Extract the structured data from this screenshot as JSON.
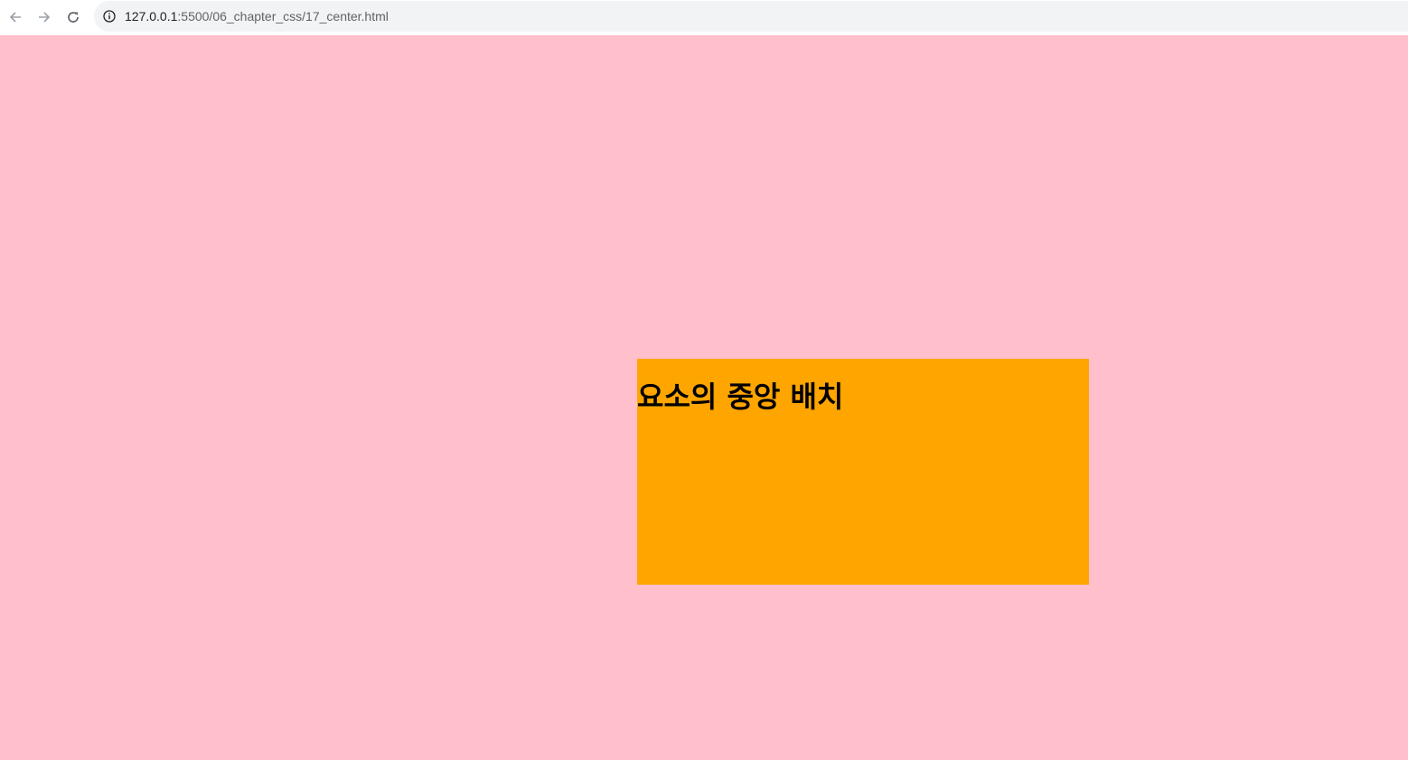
{
  "browser": {
    "url_host": "127.0.0.1",
    "url_path": ":5500/06_chapter_css/17_center.html",
    "icons": {
      "back": "arrow-left-icon",
      "forward": "arrow-right-icon",
      "reload": "reload-icon",
      "info": "info-icon"
    }
  },
  "page": {
    "background_color": "#ffc0cb",
    "box_color": "#ffa500",
    "heading": "요소의 중앙 배치"
  }
}
